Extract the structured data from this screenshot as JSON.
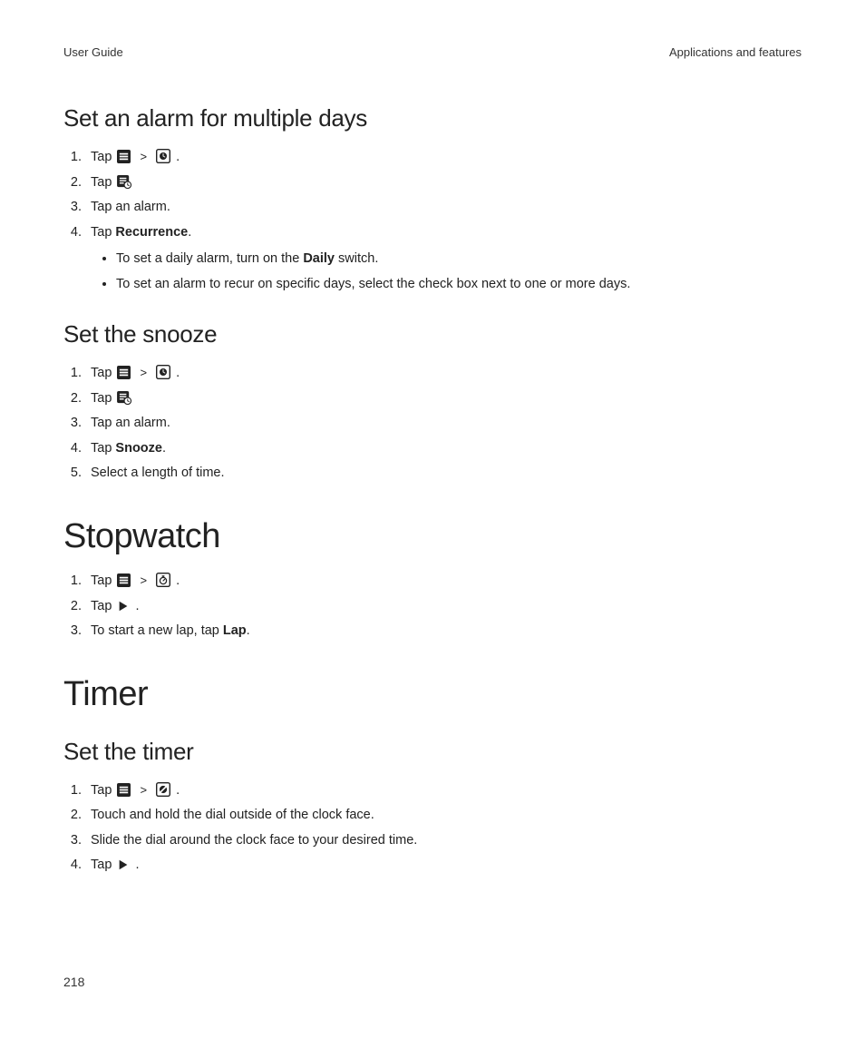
{
  "header": {
    "left": "User Guide",
    "right": "Applications and features"
  },
  "page_number": "218",
  "sections": {
    "alarm_multi": {
      "title": "Set an alarm for multiple days",
      "step1_tap": "Tap",
      "step1_sep": ">",
      "step1_end": ".",
      "step2_tap": "Tap",
      "step3": "Tap an alarm.",
      "step4_pre": "Tap ",
      "step4_bold": "Recurrence",
      "step4_post": ".",
      "bullet1_pre": "To set a daily alarm, turn on the ",
      "bullet1_bold": "Daily",
      "bullet1_post": " switch.",
      "bullet2": "To set an alarm to recur on specific days, select the check box next to one or more days."
    },
    "snooze": {
      "title": "Set the snooze",
      "step1_tap": "Tap",
      "step1_sep": ">",
      "step1_end": ".",
      "step2_tap": "Tap",
      "step3": "Tap an alarm.",
      "step4_pre": "Tap ",
      "step4_bold": "Snooze",
      "step4_post": ".",
      "step5": "Select a length of time."
    },
    "stopwatch": {
      "title": "Stopwatch",
      "step1_tap": "Tap",
      "step1_sep": ">",
      "step1_end": ".",
      "step2_tap": "Tap",
      "step2_end": ".",
      "step3_pre": "To start a new lap, tap ",
      "step3_bold": "Lap",
      "step3_post": "."
    },
    "timer": {
      "title": "Timer",
      "sub_title": "Set the timer",
      "step1_tap": "Tap",
      "step1_sep": ">",
      "step1_end": ".",
      "step2": "Touch and hold the dial outside of the clock face.",
      "step3": "Slide the dial around the clock face to your desired time.",
      "step4_tap": "Tap",
      "step4_end": "."
    }
  }
}
